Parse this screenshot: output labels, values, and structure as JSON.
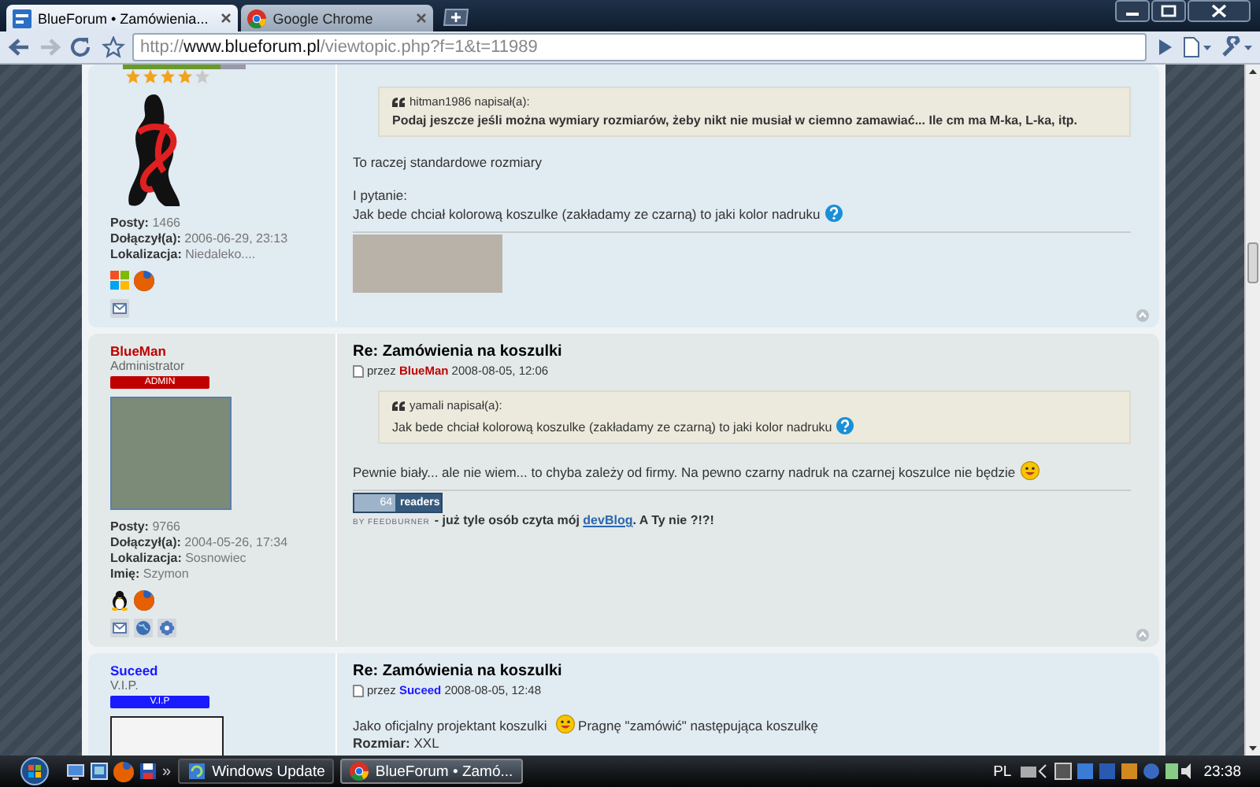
{
  "browser": {
    "tabs": [
      {
        "kind": "forum",
        "title": "BlueForum • Zamówienia...",
        "selected": true
      },
      {
        "kind": "chrome",
        "title": "Google Chrome",
        "selected": false
      }
    ],
    "back": {
      "disabled": false
    },
    "forward": {
      "disabled": true
    },
    "address": "http://**www.blueforum.pl**/viewtopic.php?f=1&t=11989"
  },
  "posts": [
    {
      "profile": {
        "stars": 4,
        "level": 0.8,
        "meta": [
          {
            "label": "Posty:",
            "value": "1466"
          },
          {
            "label": "Dołączył(a):",
            "value": "2006-06-29, 23:13"
          },
          {
            "label": "Lokalizacja:",
            "value": "Niedaleko...."
          }
        ],
        "systems": [
          {
            "kind": "windows"
          },
          {
            "kind": "firefox"
          }
        ],
        "contacts": [
          {
            "kind": "mail"
          }
        ]
      },
      "body": [
        {
          "kind": "quote",
          "author": "hitman1986 napisał(a):",
          "bold": true,
          "parts": [
            {
              "kind": "text",
              "text": "Podaj jeszcze jeśli można wymiary rozmiarów, żeby nikt nie musiał w ciemno zamawiać... Ile cm ma M-ka, L-ka, itp."
            }
          ]
        },
        {
          "kind": "para",
          "parts": [
            {
              "kind": "text",
              "text": "To raczej standardowe rozmiary"
            }
          ]
        },
        {
          "kind": "para",
          "parts": [
            {
              "kind": "text",
              "text": "I pytanie:"
            }
          ]
        },
        {
          "kind": "line",
          "parts": [
            {
              "kind": "text",
              "text": "Jak bede chciał kolorową koszulke (zakładamy ze czarną) to jaki kolor nadruku"
            },
            {
              "kind": "question"
            }
          ]
        }
      ],
      "signature": {
        "kind": "image"
      }
    },
    {
      "profile": {
        "name": "BlueMan",
        "color": "#c00000",
        "rank": "Administrator",
        "badge": "ADMIN",
        "meta": [
          {
            "label": "Posty:",
            "value": "9766"
          },
          {
            "label": "Dołączył(a):",
            "value": "2004-05-26, 17:34"
          },
          {
            "label": "Lokalizacja:",
            "value": "Sosnowiec"
          },
          {
            "label": "Imię:",
            "value": "Szymon"
          }
        ],
        "systems": [
          {
            "kind": "linux"
          },
          {
            "kind": "firefox"
          }
        ],
        "contacts": [
          {
            "kind": "mail"
          },
          {
            "kind": "www"
          },
          {
            "kind": "icq"
          }
        ]
      },
      "title": "Re: Zamówienia na koszulki",
      "byline": "przez **BlueMan** 2008-08-05, 12:06",
      "body": [
        {
          "kind": "quote",
          "author": "yamali napisał(a):",
          "bold": false,
          "parts": [
            {
              "kind": "text",
              "text": "Jak bede chciał kolorową koszulke (zakładamy ze czarną) to jaki kolor nadruku"
            },
            {
              "kind": "question"
            }
          ]
        },
        {
          "kind": "para",
          "parts": [
            {
              "kind": "text",
              "text": "Pewnie biały... ale nie wiem... to chyba zależy od firmy. Na pewno czarny nadruk na czarnej koszulce nie będzie"
            },
            {
              "kind": "grin"
            }
          ]
        }
      ],
      "signature": {
        "kind": "feedburner",
        "count": "64",
        "unit": "readers",
        "by": "BY FEEDBURNER",
        "text_before": "- już tyle osób czyta mój",
        "link": "devBlog",
        "text_after": ". A Ty nie ?!?!"
      }
    },
    {
      "profile": {
        "name": "Suceed",
        "color": "#1a1aff",
        "rank": "V.I.P.",
        "badge": "V.I.P"
      },
      "title": "Re: Zamówienia na koszulki",
      "byline": "przez **Suceed** 2008-08-05, 12:48",
      "body": [
        {
          "kind": "para",
          "parts": [
            {
              "kind": "text",
              "text": "Jako oficjalny projektant koszulki "
            },
            {
              "kind": "grin"
            },
            {
              "kind": "text",
              "text": " Pragnę \"zamówić\" następująca koszulkę"
            }
          ]
        },
        {
          "kind": "line",
          "parts": [
            {
              "kind": "text",
              "text": "**Rozmiar:** XXL"
            }
          ]
        }
      ]
    }
  ],
  "taskbar": {
    "more": "»",
    "tasks": [
      {
        "kind": "update",
        "label": "Windows Update",
        "selected": false
      },
      {
        "kind": "chrome",
        "label": "BlueForum • Zamó...",
        "selected": true
      }
    ],
    "language": "PL",
    "time": "23:38"
  }
}
